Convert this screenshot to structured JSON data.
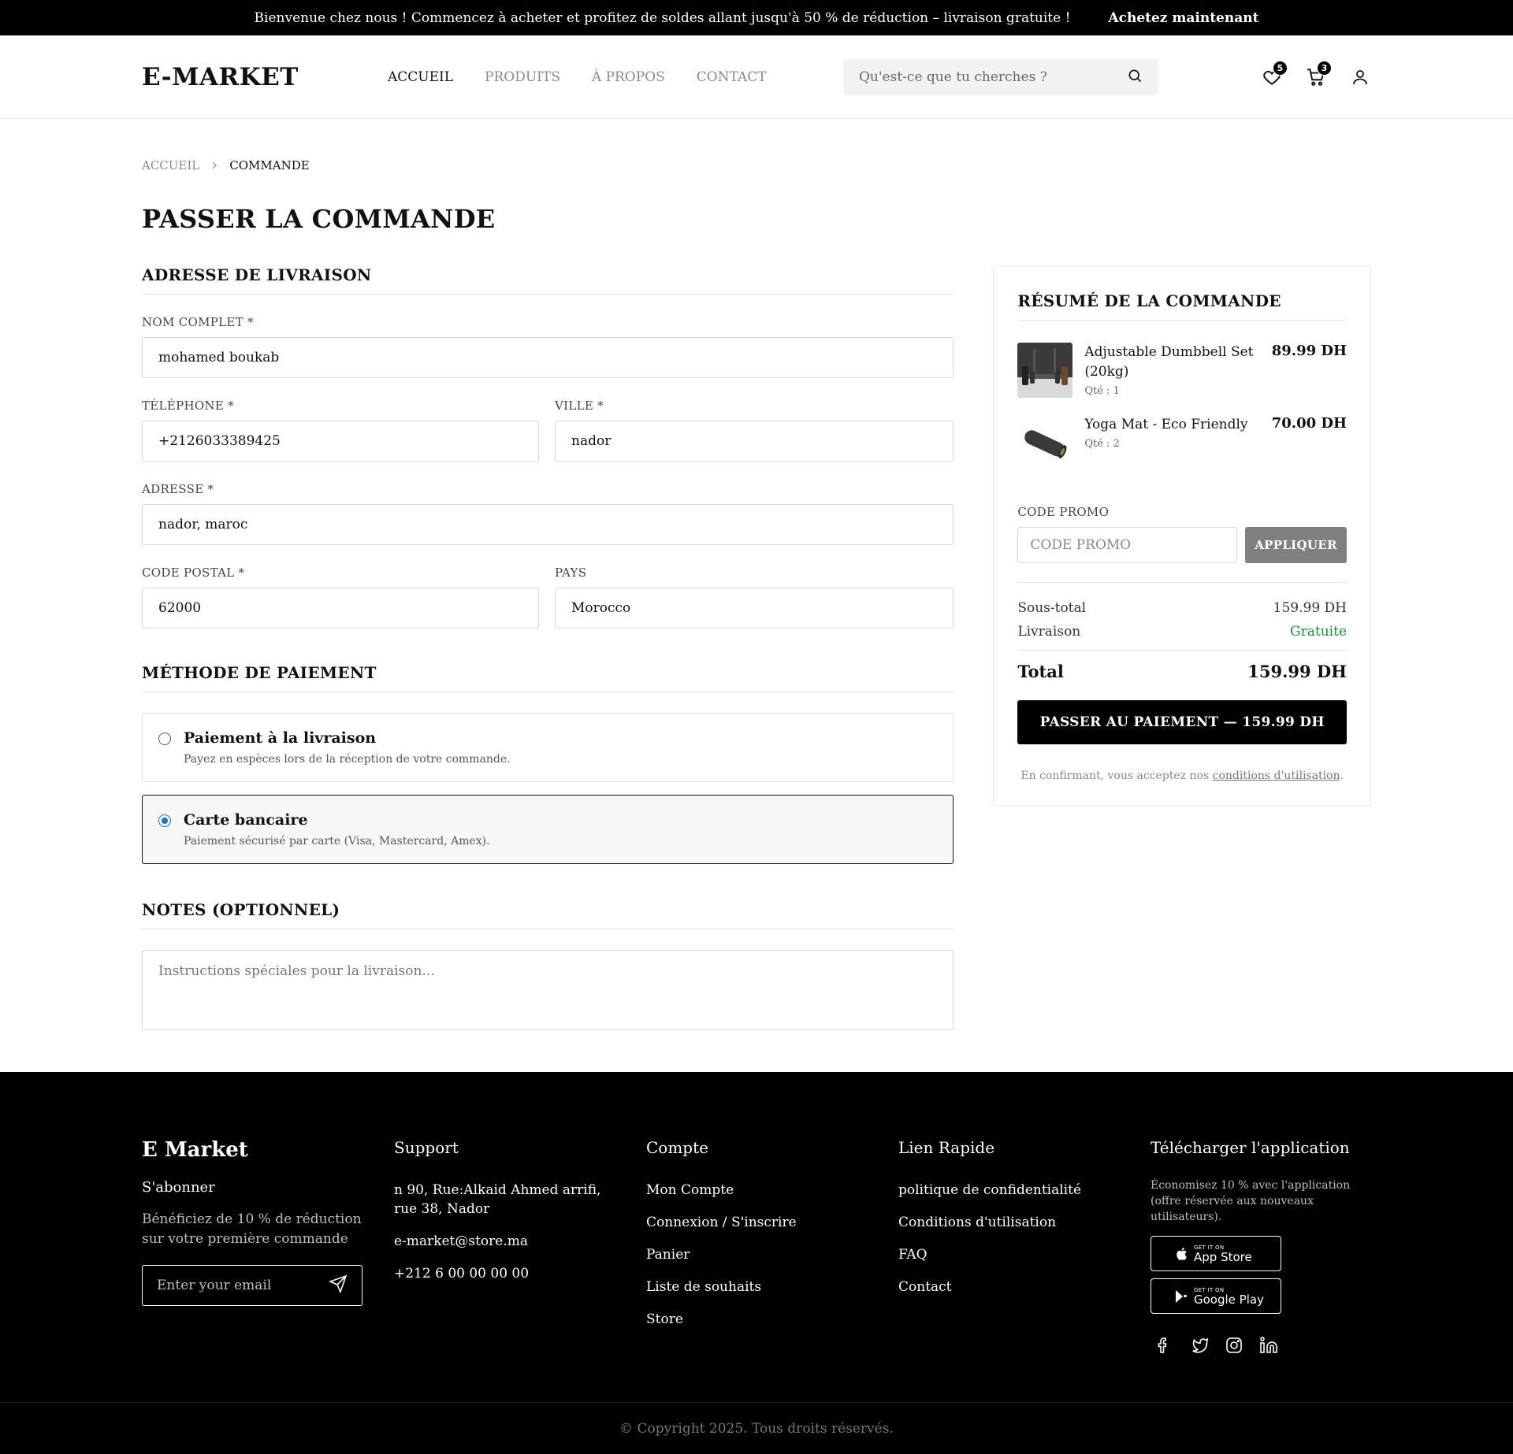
{
  "banner": {
    "message": "Bienvenue chez nous ! Commencez à acheter et profitez de soldes allant jusqu'à 50 % de réduction – livraison gratuite !",
    "cta": "Achetez maintenant"
  },
  "header": {
    "logo": "E-MARKET",
    "nav": [
      "ACCUEIL",
      "PRODUITS",
      "À PROPOS",
      "CONTACT"
    ],
    "active_nav": "ACCUEIL",
    "search_placeholder": "Qu'est-ce que tu cherches ?",
    "wishlist_count": "5",
    "cart_count": "3"
  },
  "breadcrumb": {
    "home": "ACCUEIL",
    "current": "COMMANDE"
  },
  "page_title": "PASSER LA COMMANDE",
  "shipping": {
    "title": "ADRESSE DE LIVRAISON",
    "full_name_label": "NOM COMPLET *",
    "full_name": "mohamed boukab",
    "phone_label": "TÉLÉPHONE *",
    "phone": "+2126033389425",
    "city_label": "VILLE *",
    "city": "nador",
    "address_label": "ADRESSE *",
    "address": "nador, maroc",
    "postal_label": "CODE POSTAL *",
    "postal": "62000",
    "country_label": "PAYS",
    "country": "Morocco"
  },
  "payment": {
    "title": "MÉTHODE DE PAIEMENT",
    "options": [
      {
        "name": "Paiement à la livraison",
        "desc": "Payez en espèces lors de la réception de votre commande.",
        "selected": false
      },
      {
        "name": "Carte bancaire",
        "desc": "Paiement sécurisé par carte (Visa, Mastercard, Amex).",
        "selected": true
      }
    ]
  },
  "notes": {
    "title": "NOTES (OPTIONNEL)",
    "placeholder": "Instructions spéciales pour la livraison..."
  },
  "summary": {
    "title": "RÉSUMÉ DE LA COMMANDE",
    "items": [
      {
        "name": "Adjustable Dumbbell Set (20kg)",
        "qty": "Qté : 1",
        "price": "89.99 DH",
        "image_icon": "dumbbell-image"
      },
      {
        "name": "Yoga Mat - Eco Friendly",
        "qty": "Qté : 2",
        "price": "70.00 DH",
        "image_icon": "yoga-mat-image"
      }
    ],
    "promo_label": "CODE PROMO",
    "promo_placeholder": "CODE PROMO",
    "apply": "APPLIQUER",
    "subtotal_label": "Sous-total",
    "subtotal": "159.99 DH",
    "shipping_label": "Livraison",
    "shipping_value": "Gratuite",
    "total_label": "Total",
    "total": "159.99 DH",
    "checkout": "PASSER AU PAIEMENT — 159.99 DH",
    "terms_prefix": "En confirmant, vous acceptez nos",
    "terms_link": "conditions d'utilisation",
    "terms_suffix": "."
  },
  "footer": {
    "brand": "E Market",
    "subscribe": "S'abonner",
    "subscribe_text": "Bénéficiez de 10 % de réduction sur votre première commande",
    "email_placeholder": "Enter your email",
    "support_title": "Support",
    "support": [
      "n 90, Rue:Alkaid Ahmed arrifi, rue 38, Nador",
      "e-market@store.ma",
      "+212 6 00 00 00 00"
    ],
    "account_title": "Compte",
    "account": [
      "Mon Compte",
      "Connexion / S'inscrire",
      "Panier",
      "Liste de souhaits",
      "Store"
    ],
    "quick_title": "Lien Rapide",
    "quick": [
      "politique de confidentialité",
      "Conditions d'utilisation",
      "FAQ",
      "Contact"
    ],
    "app_title": "Télécharger l'application",
    "app_text": "Économisez 10 % avec l'application (offre réservée aux nouveaux utilisateurs).",
    "app_store_small": "GET IT ON",
    "app_store": "App Store",
    "google_play_small": "GET IT ON",
    "google_play": "Google Play",
    "socials": [
      "facebook-icon",
      "twitter-icon",
      "instagram-icon",
      "linkedin-icon"
    ],
    "copyright": "© Copyright 2025. Tous droits réservés."
  },
  "colors": {
    "accent": "#000000",
    "free_shipping": "#1e8a3c",
    "radio_selected": "#1a73c8",
    "apply_button": "#808080"
  }
}
